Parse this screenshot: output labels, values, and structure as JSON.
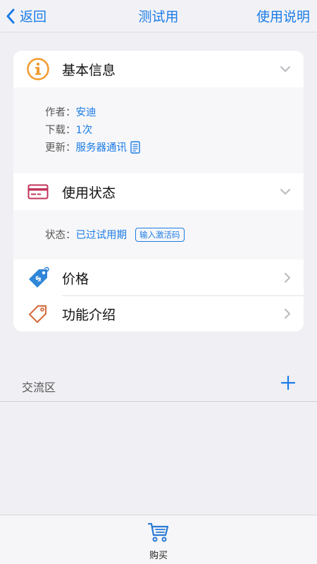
{
  "nav": {
    "back_label": "返回",
    "title": "测试用",
    "right_label": "使用说明"
  },
  "basic_info": {
    "title": "基本信息",
    "author_key": "作者：",
    "author_value": "安迪",
    "downloads_key": "下载：",
    "downloads_value": "1次",
    "update_key": "更新：",
    "update_value": "服务器通讯"
  },
  "usage_status": {
    "title": "使用状态",
    "status_key": "状态：",
    "status_value": "已过试用期",
    "activate_label": "输入激活码"
  },
  "price": {
    "title": "价格"
  },
  "features": {
    "title": "功能介绍"
  },
  "community": {
    "title": "交流区"
  },
  "tabbar": {
    "buy_label": "购买"
  },
  "colors": {
    "accent": "#1b7ce6",
    "info_icon": "#f29a2e",
    "card_icon": "#c2345a",
    "tag_icon": "#d46a3a"
  },
  "icons": {
    "back": "chevron-left-icon",
    "info": "info-icon",
    "card": "credit-card-icon",
    "price": "price-tag-icon",
    "features": "tag-outline-icon",
    "doc": "document-icon",
    "plus": "plus-icon",
    "cart": "cart-icon"
  }
}
